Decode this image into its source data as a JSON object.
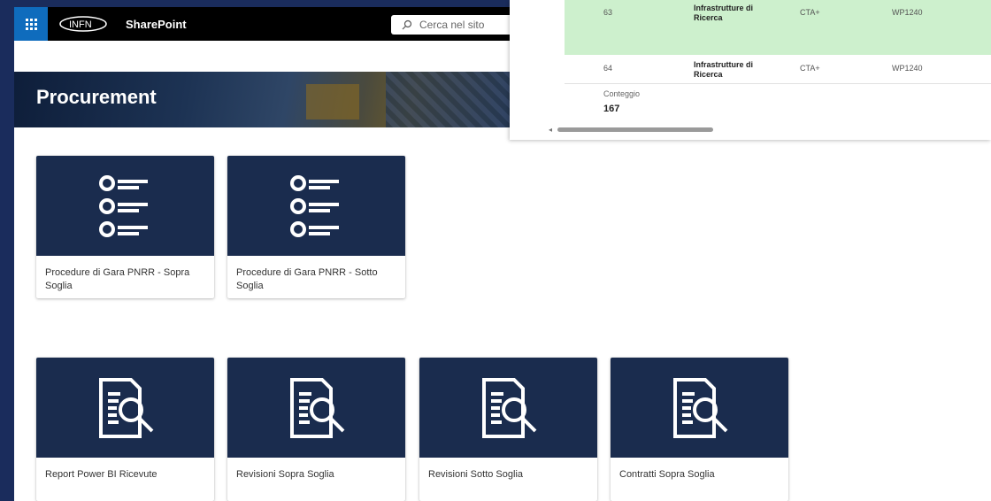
{
  "suitebar": {
    "app_name": "SharePoint",
    "logo_text": "INFN",
    "search_placeholder": "Cerca nel sito"
  },
  "hero": {
    "title": "Procurement"
  },
  "cards_row1": [
    {
      "label": "Procedure di Gara PNRR - Sopra Soglia",
      "icon": "list-icon"
    },
    {
      "label": "Procedure di Gara PNRR - Sotto Soglia",
      "icon": "list-icon"
    }
  ],
  "cards_row2": [
    {
      "label": "Report Power BI Ricevute",
      "icon": "report-search-icon"
    },
    {
      "label": "Revisioni Sopra Soglia",
      "icon": "report-search-icon"
    },
    {
      "label": "Revisioni Sotto Soglia",
      "icon": "report-search-icon"
    },
    {
      "label": "Contratti Sopra Soglia",
      "icon": "report-search-icon"
    }
  ],
  "overlay": {
    "rows": [
      {
        "id": "63",
        "area": "Infrastrutture di Ricerca",
        "project": "CTA+",
        "wp": "WP1240",
        "highlight": "#cdf0cd"
      },
      {
        "id": "64",
        "area": "Infrastrutture di Ricerca",
        "project": "CTA+",
        "wp": "WP1240"
      }
    ],
    "count_label": "Conteggio",
    "count_value": "167"
  },
  "colors": {
    "page_bg": "#1a2c5c",
    "tile_bg": "#1a2c4e",
    "suitebar_accent": "#0f6cbd",
    "row_highlight": "#cdf0cd"
  }
}
